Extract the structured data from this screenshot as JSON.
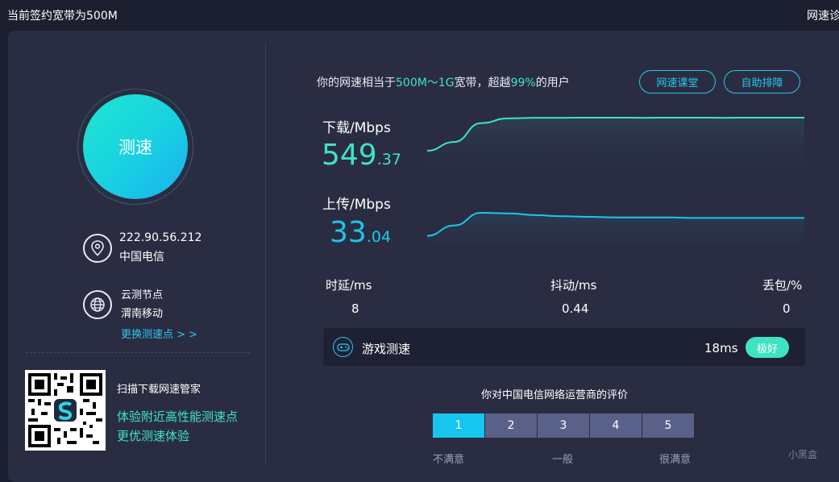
{
  "topbar": {
    "bandwidth_text": "当前签约宽带为500M",
    "diagnose_label": "网速诊断"
  },
  "left": {
    "speed_button_label": "测速",
    "ip": "222.90.56.212",
    "isp": "中国电信",
    "node_title": "云测节点",
    "node_name": "渭南移动",
    "change_node_label": "更换测速点 > >",
    "qr_title": "扫描下载网速管家",
    "qr_line1": "体验附近高性能测速点",
    "qr_line2": "更优测速体验",
    "icons": [
      "location-pin-icon",
      "globe-icon",
      "qr-code-icon"
    ]
  },
  "headline": {
    "prefix": "你的网速相当于",
    "range": "500M～1G",
    "mid": "宽带，超越",
    "percent": "99%",
    "suffix": "的用户"
  },
  "buttons": {
    "course": "网速课堂",
    "troubleshoot": "自助排障"
  },
  "download": {
    "label": "下载/Mbps",
    "value_int": "549",
    "value_dec": ".37"
  },
  "upload": {
    "label": "上传/Mbps",
    "value_int": "33",
    "value_dec": ".04"
  },
  "chart_data": {
    "type": "line",
    "series": [
      {
        "name": "下载/Mbps",
        "color": "#3fe3c4",
        "values": [
          60,
          190,
          470,
          540,
          548,
          549,
          550,
          550,
          549,
          550,
          550,
          549,
          550,
          550,
          550
        ]
      },
      {
        "name": "上传/Mbps",
        "color": "#1cc6ee",
        "values": [
          2,
          20,
          42,
          41,
          38,
          36,
          35,
          34,
          34,
          34,
          33,
          33,
          33,
          33,
          33
        ]
      }
    ]
  },
  "stats": {
    "latency_label": "时延/ms",
    "latency_value": "8",
    "jitter_label": "抖动/ms",
    "jitter_value": "0.44",
    "loss_label": "丢包/%",
    "loss_value": "0"
  },
  "game": {
    "label": "游戏测速",
    "ms": "18ms",
    "badge": "极好",
    "icon": "gamepad-icon"
  },
  "rating": {
    "title": "你对中国电信网络运营商的评价",
    "options": [
      "1",
      "2",
      "3",
      "4",
      "5"
    ],
    "selected": 1,
    "cap_low": "不满意",
    "cap_mid": "一般",
    "cap_high": "很满意"
  },
  "watermark": "小黑盒",
  "colors": {
    "accent_green": "#3fe3c4",
    "accent_blue": "#1cc6ee",
    "panel": "#2a2d42",
    "background": "#1c1f30"
  }
}
